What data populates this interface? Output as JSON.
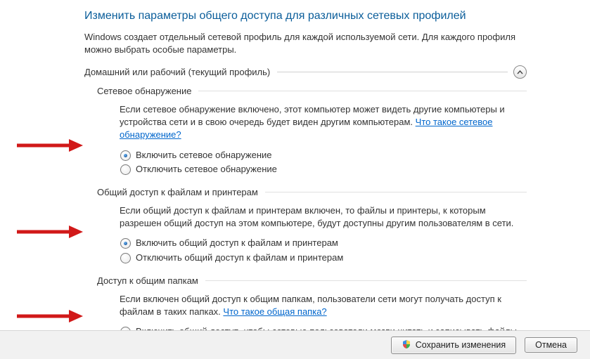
{
  "page_title": "Изменить параметры общего доступа для различных сетевых профилей",
  "page_desc": "Windows создает отдельный сетевой профиль для каждой используемой сети. Для каждого профиля можно выбрать особые параметры.",
  "profile_title": "Домашний или рабочий (текущий профиль)",
  "groups": {
    "discovery": {
      "title": "Сетевое обнаружение",
      "text_before": "Если сетевое обнаружение включено, этот компьютер может видеть другие компьютеры и устройства сети и в свою очередь будет виден другим компьютерам. ",
      "link": "Что такое сетевое обнаружение?",
      "opt_on": "Включить сетевое обнаружение",
      "opt_off": "Отключить сетевое обнаружение"
    },
    "fileshare": {
      "title": "Общий доступ к файлам и принтерам",
      "text": "Если общий доступ к файлам и принтерам включен, то файлы и принтеры, к которым разрешен общий доступ на этом компьютере, будут доступны другим пользователям в сети.",
      "opt_on": "Включить общий доступ к файлам и принтерам",
      "opt_off": "Отключить общий доступ к файлам и принтерам"
    },
    "public": {
      "title": "Доступ к общим папкам",
      "text_before": "Если включен общий доступ к общим папкам, пользователи сети могут получать доступ к файлам в таких папках. ",
      "link": "Что такое общая папка?",
      "opt_on": "Включить общий доступ, чтобы сетевые пользователи могли читать и записывать файлы в общих папках"
    }
  },
  "buttons": {
    "save": "Сохранить изменения",
    "cancel": "Отмена"
  },
  "colors": {
    "heading": "#0a5d9a",
    "link": "#0066cc",
    "arrow": "#d11919"
  }
}
